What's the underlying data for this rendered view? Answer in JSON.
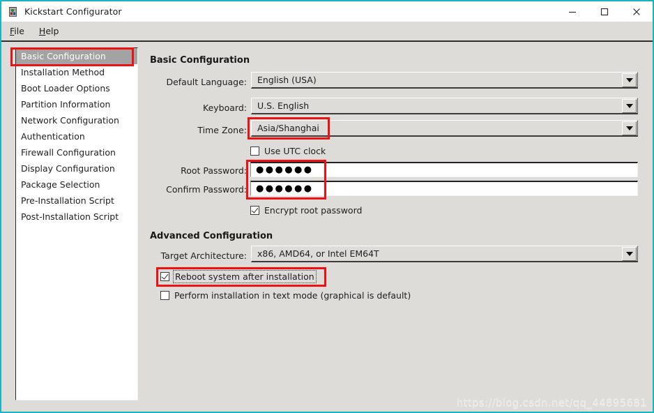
{
  "window": {
    "title": "Kickstart Configurator",
    "icon": "kickstart-app-icon",
    "minimize_label": "—",
    "maximize_label": "□",
    "close_label": "✕",
    "border_color": "#1ab3c0"
  },
  "menubar": {
    "items": [
      {
        "label": "File",
        "accel": "F"
      },
      {
        "label": "Help",
        "accel": "H"
      }
    ]
  },
  "sidebar": {
    "items": [
      {
        "label": "Basic Configuration",
        "selected": true
      },
      {
        "label": "Installation Method",
        "selected": false
      },
      {
        "label": "Boot Loader Options",
        "selected": false
      },
      {
        "label": "Partition Information",
        "selected": false
      },
      {
        "label": "Network Configuration",
        "selected": false
      },
      {
        "label": "Authentication",
        "selected": false
      },
      {
        "label": "Firewall Configuration",
        "selected": false
      },
      {
        "label": "Display Configuration",
        "selected": false
      },
      {
        "label": "Package Selection",
        "selected": false
      },
      {
        "label": "Pre-Installation Script",
        "selected": false
      },
      {
        "label": "Post-Installation Script",
        "selected": false
      }
    ],
    "selected_bg": "#a3a3a3",
    "selected_fg": "#ffffff"
  },
  "basic": {
    "heading": "Basic Configuration",
    "default_language": {
      "label": "Default Language:",
      "value": "English (USA)"
    },
    "keyboard": {
      "label": "Keyboard:",
      "value": "U.S. English"
    },
    "time_zone": {
      "label": "Time Zone:",
      "value": "Asia/Shanghai",
      "highlighted": true
    },
    "use_utc": {
      "label": "Use UTC clock",
      "checked": false
    },
    "root_password": {
      "label": "Root Password:",
      "value": "●●●●●●"
    },
    "confirm_password": {
      "label": "Confirm Password:",
      "value": "●●●●●●"
    },
    "encrypt_password": {
      "label": "Encrypt root password",
      "checked": true
    }
  },
  "advanced": {
    "heading": "Advanced Configuration",
    "target_architecture": {
      "label": "Target Architecture:",
      "value": "x86, AMD64, or Intel EM64T"
    },
    "reboot_after_install": {
      "label": "Reboot system after installation",
      "checked": true,
      "focused": true,
      "highlighted": true
    },
    "text_mode_install": {
      "label": "Perform installation in text mode (graphical is default)",
      "checked": false
    }
  },
  "annotations": {
    "color": "#ee1111",
    "boxes": [
      {
        "name": "sidebar-basic-configuration"
      },
      {
        "name": "time-zone-value"
      },
      {
        "name": "password-fields"
      },
      {
        "name": "reboot-after-installation"
      }
    ]
  },
  "watermark": {
    "text": "https://blog.csdn.net/qq_44895681"
  }
}
